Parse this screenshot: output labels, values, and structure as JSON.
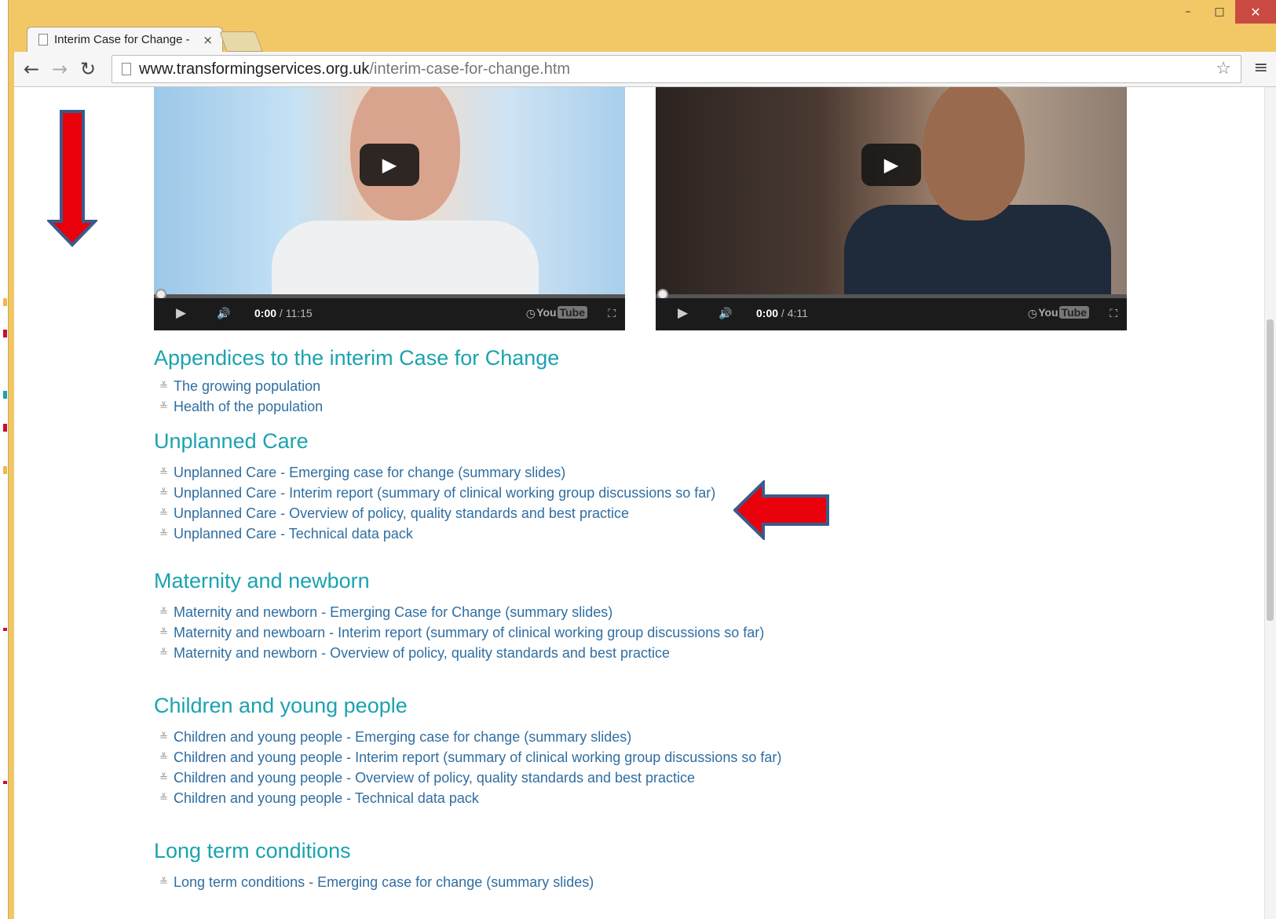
{
  "browser": {
    "tab_title": "Interim Case for Change -",
    "tab_close": "×",
    "url_domain": "www.transformingservices.org.uk",
    "url_path": "/interim-case-for-change.htm",
    "window_controls": {
      "minimize": "–",
      "maximize": "□",
      "close": "✕"
    }
  },
  "videos": [
    {
      "time_current": "0:00",
      "time_total": " / 11:15",
      "logo": "You",
      "logo_box": "Tube"
    },
    {
      "time_current": "0:00",
      "time_total": " / 4:11",
      "logo": "You",
      "logo_box": "Tube"
    }
  ],
  "sections": {
    "appendices": {
      "title": "Appendices to the interim Case for Change",
      "items": [
        "The growing population",
        "Health of the population"
      ]
    },
    "unplanned": {
      "title": "Unplanned Care",
      "items": [
        "Unplanned Care - Emerging case for change (summary slides)",
        "Unplanned Care - Interim report (summary of clinical working group discussions so far)",
        "Unplanned Care - Overview of policy, quality standards and best practice",
        "Unplanned Care - Technical data pack"
      ]
    },
    "maternity": {
      "title": "Maternity and newborn",
      "items": [
        "Maternity and newborn - Emerging Case for Change (summary slides)",
        "Maternity and newboarn - Interim report (summary of clinical working group discussions so far)",
        "Maternity and newborn - Overview of policy, quality standards and best practice"
      ]
    },
    "children": {
      "title": "Children and young people",
      "items": [
        "Children and young people - Emerging case for change (summary slides)",
        "Children and young people - Interim report (summary of clinical working group discussions so far)",
        "Children and young people - Overview of policy, quality standards and best practice",
        "Children and young people - Technical data pack"
      ]
    },
    "longterm": {
      "title": "Long term conditions",
      "items": [
        "Long term conditions - Emerging case for change (summary slides)"
      ]
    }
  },
  "annotation_colors": {
    "arrow_fill": "#e8000b",
    "arrow_stroke": "#3a5b8a"
  },
  "link_color": "#2f6ea2",
  "heading_color": "#1aa3b0"
}
